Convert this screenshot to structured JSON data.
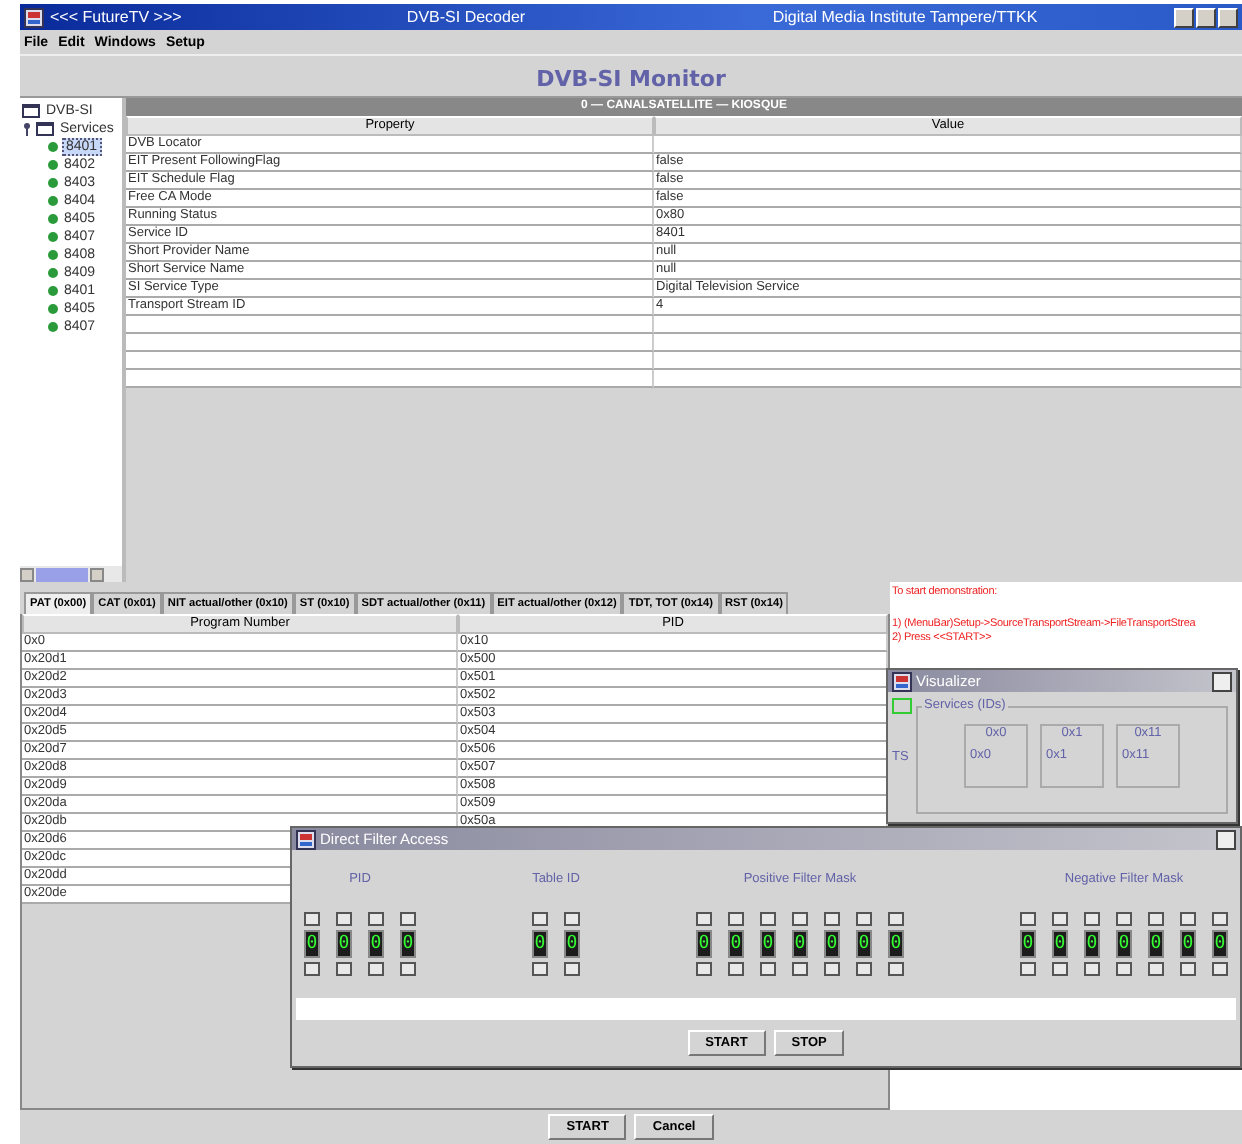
{
  "window": {
    "title_left": "<<< FutureTV >>>",
    "title_center": "DVB-SI Decoder",
    "title_right": "Digital Media Institute Tampere/TTKK"
  },
  "menu": [
    "File",
    "Edit",
    "Windows",
    "Setup"
  ],
  "monitor_title": "DVB-SI Monitor",
  "tree": {
    "label": "DVB-SI",
    "children": [
      {
        "label": "Services",
        "expanded": true,
        "children": [
          {
            "label": "8401",
            "selected": true
          },
          {
            "label": "8402",
            "selected": false
          },
          {
            "label": "8403",
            "selected": false
          },
          {
            "label": "8404",
            "selected": false
          },
          {
            "label": "8405",
            "selected": false
          },
          {
            "label": "8407",
            "selected": false
          },
          {
            "label": "8408",
            "selected": false
          },
          {
            "label": "8409",
            "selected": false
          },
          {
            "label": "8401",
            "selected": false
          },
          {
            "label": "8405",
            "selected": false
          },
          {
            "label": "8407",
            "selected": false
          }
        ]
      }
    ]
  },
  "service_panel": {
    "title": "0 — CANALSATELLITE — KIOSQUE",
    "columns": [
      "Property",
      "Value"
    ],
    "rows": [
      [
        "DVB Locator"
      ],
      [
        "EIT Present FollowingFlag",
        "false"
      ],
      [
        "EIT Schedule Flag",
        "false"
      ],
      [
        "Free CA Mode",
        "false"
      ],
      [
        "Running Status",
        "0x80"
      ],
      [
        "Service ID",
        "8401"
      ],
      [
        "Short Provider Name",
        "null"
      ],
      [
        "Short Service Name",
        "null"
      ],
      [
        "SI Service Type",
        "Digital Television Service"
      ],
      [
        "Transport Stream ID",
        "4"
      ]
    ]
  },
  "tabs": [
    {
      "label": "PAT (0x00)",
      "selected": true
    },
    {
      "label": "CAT (0x01)",
      "selected": false
    },
    {
      "label": "NIT actual/other (0x10)",
      "selected": false
    },
    {
      "label": "ST (0x10)",
      "selected": false
    },
    {
      "label": "SDT actual/other (0x11)",
      "selected": false
    },
    {
      "label": "EIT actual/other (0x12)",
      "selected": false
    },
    {
      "label": "TDT, TOT (0x14)",
      "selected": false
    },
    {
      "label": "RST (0x14)",
      "selected": false
    }
  ],
  "pat_table": {
    "columns": [
      "Program Number",
      "PID"
    ],
    "rows": [
      [
        "0x0",
        "0x10"
      ],
      [
        "0x20d1",
        "0x500"
      ],
      [
        "0x20d2",
        "0x501"
      ],
      [
        "0x20d3",
        "0x502"
      ],
      [
        "0x20d4",
        "0x503"
      ],
      [
        "0x20d5",
        "0x504"
      ],
      [
        "0x20d7",
        "0x506"
      ],
      [
        "0x20d8",
        "0x507"
      ],
      [
        "0x20d9",
        "0x508"
      ],
      [
        "0x20da",
        "0x509"
      ],
      [
        "0x20db",
        "0x50a"
      ],
      [
        "0x20d6"
      ],
      [
        "0x20dc"
      ],
      [
        "0x20dd"
      ],
      [
        "0x20de"
      ]
    ]
  },
  "instructions": [
    "To start demonstration:",
    "1) (MenuBar)Setup->SourceTransportStream->FileTransportStrea",
    "2) Press <<START>>"
  ],
  "visualizer": {
    "title": "Visualizer",
    "group": "Services (IDs)",
    "side_label": "TS",
    "boxes": [
      {
        "title": "0x0",
        "value": "0x0"
      },
      {
        "title": "0x1",
        "value": "0x1"
      },
      {
        "title": "0x11",
        "value": "0x11"
      }
    ]
  },
  "filter_window": {
    "title": "Direct Filter Access",
    "groups": [
      {
        "label": "PID",
        "digits": [
          "0",
          "0",
          "0",
          "0"
        ]
      },
      {
        "label": "Table ID",
        "digits": [
          "0",
          "0"
        ]
      },
      {
        "label": "Positive Filter Mask",
        "digits": [
          "0",
          "0",
          "0",
          "0",
          "0",
          "0",
          "0"
        ]
      },
      {
        "label": "Negative Filter Mask",
        "digits": [
          "0",
          "0",
          "0",
          "0",
          "0",
          "0",
          "0"
        ]
      }
    ],
    "buttons": [
      "START",
      "STOP"
    ]
  },
  "buttons": [
    "START",
    "Cancel"
  ]
}
